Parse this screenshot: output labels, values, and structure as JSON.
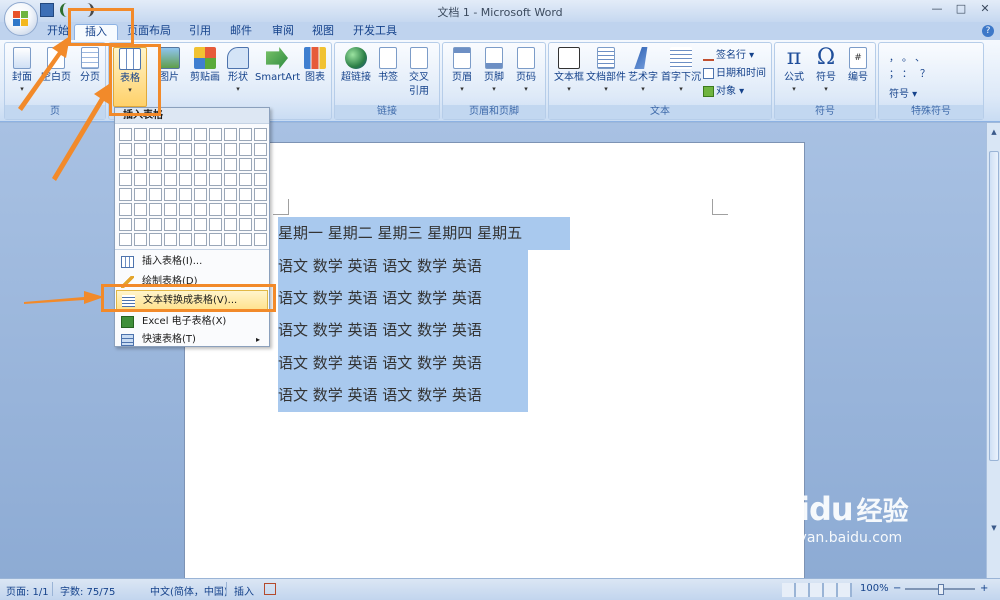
{
  "window": {
    "title": "文档 1 - Microsoft Word",
    "minimize": "—",
    "maximize": "□",
    "close": "✕"
  },
  "tabs": [
    {
      "label": "开始"
    },
    {
      "label": "插入"
    },
    {
      "label": "页面布局"
    },
    {
      "label": "引用"
    },
    {
      "label": "邮件"
    },
    {
      "label": "审阅"
    },
    {
      "label": "视图"
    },
    {
      "label": "开发工具"
    }
  ],
  "active_tab": "插入",
  "ribbon": {
    "groups": {
      "page": "页",
      "links": "链接",
      "header_footer": "页眉和页脚",
      "text": "文本",
      "symbols": "符号",
      "special_symbols": "特殊符号"
    },
    "buttons": {
      "cover": "封面",
      "blank_page": "空白页",
      "page_break": "分页",
      "table": "表格",
      "picture": "图片",
      "clipart": "剪贴画",
      "shapes": "形状",
      "smartart": "SmartArt",
      "chart": "图表",
      "hyperlink": "超链接",
      "bookmark": "书签",
      "cross_ref_1": "交叉",
      "cross_ref_2": "引用",
      "header": "页眉",
      "footer": "页脚",
      "page_number": "页码",
      "textbox": "文本框",
      "quickparts": "文档部件",
      "wordart": "艺术字",
      "dropcap": "首字下沉",
      "signature": "签名行 ▾",
      "datetime": "日期和时间",
      "object": "对象 ▾",
      "equation": "公式",
      "symbol": "符号",
      "number": "编号",
      "special_symbol": "符号 ▾"
    },
    "special_glyphs": [
      "，",
      "。",
      "、",
      "；",
      "：",
      "？"
    ]
  },
  "table_menu": {
    "header": "插入表格",
    "items": [
      {
        "label": "插入表格(I)..."
      },
      {
        "label": "绘制表格(D)"
      },
      {
        "label": "文本转换成表格(V)..."
      },
      {
        "label": "Excel 电子表格(X)"
      },
      {
        "label": "快速表格(T)"
      }
    ],
    "highlighted_item": "文本转换成表格(V)...",
    "submenu_arrow": "▸"
  },
  "document": {
    "rows": [
      {
        "text": "星期一  星期二  星期三  星期四  星期五"
      },
      {
        "text": "语文  数学  英语  语文  数学  英语"
      },
      {
        "text": "语文  数学  英语  语文  数学  英语"
      },
      {
        "text": "语文  数学  英语  语文  数学  英语"
      },
      {
        "text": "语文  数学  英语  语文  数学  英语"
      },
      {
        "text": "语文  数学  英语  语文  数学  英语"
      }
    ]
  },
  "statusbar": {
    "page": "页面: 1/1",
    "words": "字数: 75/75",
    "language": "中文(简体，中国)",
    "mode": "插入",
    "zoom": "100%",
    "zoom_out": "−",
    "zoom_in": "+"
  },
  "watermark": {
    "brand": "Bai",
    "paw": "du",
    "suffix": "经验",
    "url": "jingyan.baidu.com"
  },
  "colors": {
    "accent": "#f28a2a",
    "selection": "#a9c9ee",
    "ribbon": "#dde9f8"
  },
  "icons": {
    "scroll_up": "▲",
    "scroll_down": "▼",
    "dropdown_arrow": "▾",
    "help": "?"
  }
}
